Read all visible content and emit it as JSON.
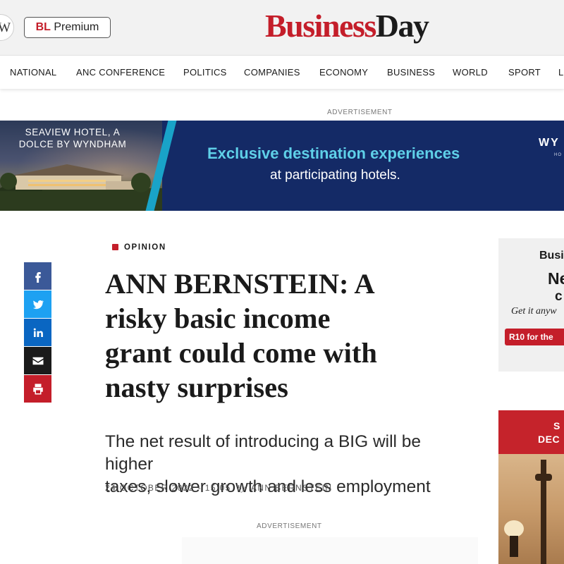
{
  "header": {
    "w_mark": "W",
    "premium": {
      "prefix": "BL",
      "label": "Premium"
    },
    "logo": {
      "part1": "Business",
      "part2": "Day"
    }
  },
  "nav": {
    "items": [
      "NATIONAL",
      "ANC CONFERENCE",
      "POLITICS",
      "COMPANIES",
      "ECONOMY",
      "BUSINESS",
      "WORLD",
      "SPORT",
      "L"
    ]
  },
  "ads": {
    "label_top": "ADVERTISEMENT",
    "label_bottom": "ADVERTISEMENT",
    "banner": {
      "hotel_line1": "SEAVIEW HOTEL, A",
      "hotel_line2": "DOLCE BY WYNDHAM",
      "headline": "Exclusive destination experiences",
      "sub": "at participating hotels.",
      "brand": "WY",
      "brand_sub": "HO",
      "stripe_color": "#19a3c8",
      "bg_color": "#142a66",
      "headline_color": "#5fd0e8"
    }
  },
  "article": {
    "section": "OPINION",
    "headline_lines": [
      "ANN BERNSTEIN: A",
      "risky basic income",
      "grant could come with",
      "nasty surprises"
    ],
    "subheadline_lines": [
      "The net result of introducing a BIG will be higher",
      "taxes, slower growth and less employment"
    ],
    "date": "24 OCTOBER 2022 - 15:05",
    "by": "by",
    "author": "ANN BERNSTEIN",
    "accent_color": "#c41e2a"
  },
  "share": [
    {
      "icon": "facebook-icon",
      "color": "#3b5998"
    },
    {
      "icon": "twitter-icon",
      "color": "#1da1f2"
    },
    {
      "icon": "linkedin-icon",
      "color": "#0a66c2"
    },
    {
      "icon": "email-icon",
      "color": "#1a1a1a"
    },
    {
      "icon": "print-icon",
      "color": "#c41e2a"
    }
  ],
  "sidebar": {
    "promo": {
      "line1": "Busi",
      "line2": "Ne",
      "line3": "c",
      "line4": "Get it anyw",
      "cta": "R10 for the"
    },
    "ad2": {
      "line1": "S",
      "line2": "DEC"
    }
  }
}
